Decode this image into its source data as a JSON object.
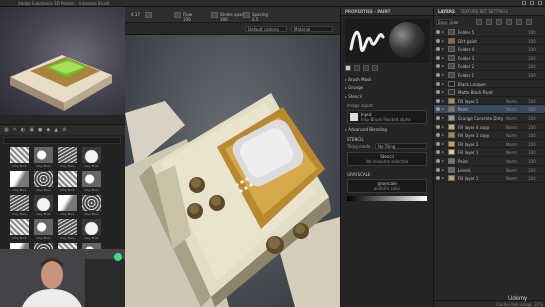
{
  "window": {
    "title": "Adobe Substance 3D Painter - Inksense Brush"
  },
  "toolbar": {
    "size_value": "4.17",
    "flow_label": "Flow",
    "flow_value": "100",
    "stroke_opacity_label": "Stroke opac",
    "stroke_opacity_value": "100",
    "spacing_label": "Spacing",
    "spacing_value": "2.5"
  },
  "viewbar": {
    "camera_select": "Default camera",
    "mode_select": "Material"
  },
  "properties": {
    "header": "PROPERTIES - PAINT",
    "sections": {
      "brush_mask": "Brush Mask",
      "grunge": "Grunge",
      "stencil": "Stencil",
      "advanced_blending": "Advanced Blending"
    },
    "image_inputs_label": "Image inputs",
    "input_name": "Input",
    "input_value": "Inky Brush Painted alpha",
    "stencil_label": "STENCIL",
    "tiling_label": "Tiling mode",
    "tiling_value": "No Tiling",
    "stencil_btn_title": "Stencil",
    "stencil_btn_sub": "No resource selected",
    "grayscale_label": "GRAYSCALE",
    "color_title": "grayscale",
    "color_sub": "uniform color"
  },
  "layers": {
    "tab_layers": "LAYERS",
    "tab_texture_set": "TEXTURE SET SETTINGS",
    "blend_dropdown": "Base color",
    "rows": [
      {
        "name": "Folder 5",
        "blend": "",
        "opacity": "100"
      },
      {
        "name": "Dirt paint",
        "blend": "",
        "opacity": "100"
      },
      {
        "name": "Folder 4",
        "blend": "",
        "opacity": "100"
      },
      {
        "name": "Folder 3",
        "blend": "",
        "opacity": "100"
      },
      {
        "name": "Folder 2",
        "blend": "",
        "opacity": "100"
      },
      {
        "name": "Folder 1",
        "blend": "",
        "opacity": "100"
      },
      {
        "name": "Black Lacquer",
        "blend": "",
        "opacity": ""
      },
      {
        "name": "Matte Black Paint",
        "blend": "",
        "opacity": ""
      },
      {
        "name": "Fill layer 5",
        "blend": "Norm",
        "opacity": "100"
      },
      {
        "name": "Paint",
        "blend": "Norm",
        "opacity": "100"
      },
      {
        "name": "Grunge Concrete Dirty",
        "blend": "Norm",
        "opacity": "100"
      },
      {
        "name": "Fill layer 4 copy",
        "blend": "Norm",
        "opacity": "100"
      },
      {
        "name": "Fill layer 3 copy",
        "blend": "Norm",
        "opacity": "100"
      },
      {
        "name": "Fill layer 2",
        "blend": "Norm",
        "opacity": "100"
      },
      {
        "name": "Fill layer 1",
        "blend": "Norm",
        "opacity": "100"
      },
      {
        "name": "Paint",
        "blend": "Norm",
        "opacity": "100"
      },
      {
        "name": "Levels",
        "blend": "Norm",
        "opacity": "100"
      },
      {
        "name": "Fill layer 1",
        "blend": "Norm",
        "opacity": "100"
      }
    ],
    "selected_index": 9,
    "footer": "Cache disk usage: 31%"
  },
  "shelf": {
    "tiles": [
      "Inky Brus",
      "Inky Brus",
      "Inky Brus",
      "Inky Brus",
      "Inky Brus",
      "Inky Brus",
      "Inky Brus",
      "Inky Brus",
      "Inky Brus",
      "Inky Brus",
      "Inky Brus",
      "Inky Brus",
      "Inky Brus",
      "Inky Brus",
      "Inky Brus",
      "Inky Brus",
      "Inky Brus",
      "Inky Brus",
      "Inky Brus",
      "Inky Brus",
      "Inky Brus",
      "Inky Brus",
      "Inky Brus",
      "Inky Brus"
    ]
  },
  "watermark": "Udemy"
}
